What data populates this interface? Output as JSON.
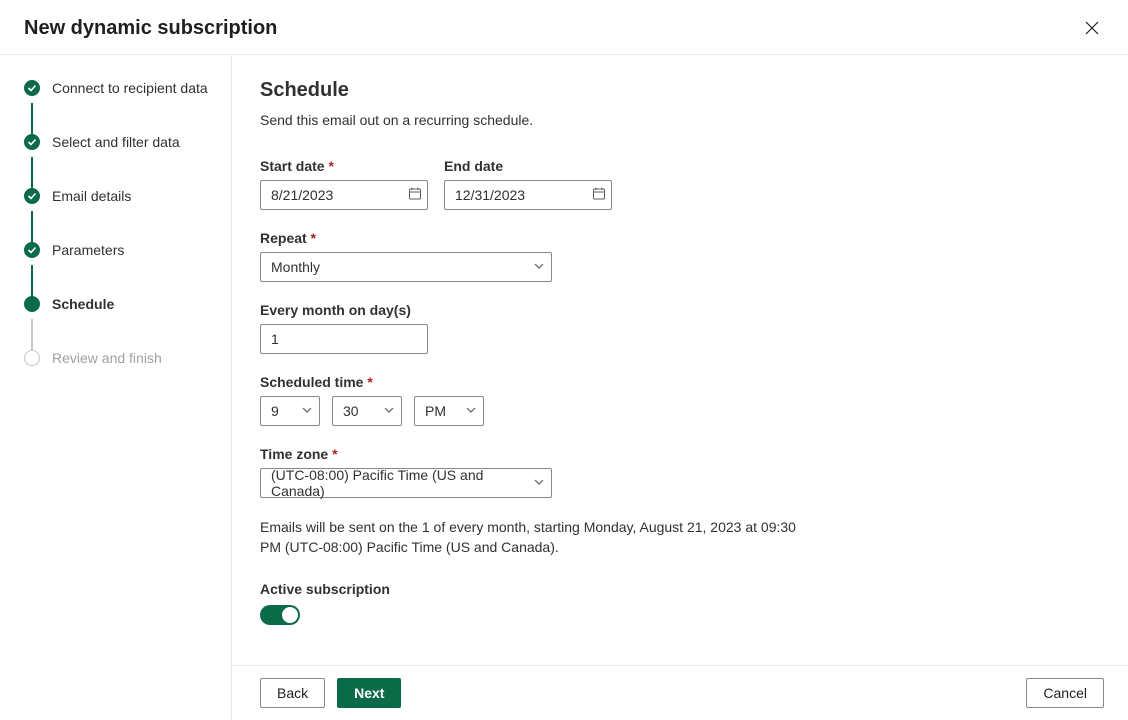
{
  "header": {
    "title": "New dynamic subscription"
  },
  "steps": [
    {
      "label": "Connect to recipient data",
      "state": "completed"
    },
    {
      "label": "Select and filter data",
      "state": "completed"
    },
    {
      "label": "Email details",
      "state": "completed"
    },
    {
      "label": "Parameters",
      "state": "completed"
    },
    {
      "label": "Schedule",
      "state": "current"
    },
    {
      "label": "Review and finish",
      "state": "pending"
    }
  ],
  "page": {
    "title": "Schedule",
    "desc": "Send this email out on a recurring schedule."
  },
  "form": {
    "start_date": {
      "label": "Start date",
      "value": "8/21/2023"
    },
    "end_date": {
      "label": "End date",
      "value": "12/31/2023"
    },
    "repeat": {
      "label": "Repeat",
      "value": "Monthly"
    },
    "month_days": {
      "label": "Every month on day(s)",
      "value": "1"
    },
    "scheduled_time": {
      "label": "Scheduled time",
      "hour": "9",
      "minute": "30",
      "ampm": "PM"
    },
    "time_zone": {
      "label": "Time zone",
      "value": "(UTC-08:00) Pacific Time (US and Canada)"
    },
    "summary": "Emails will be sent on the 1 of every month, starting Monday, August 21, 2023 at 09:30 PM (UTC-08:00) Pacific Time (US and Canada).",
    "active_subscription": {
      "label": "Active subscription",
      "value": true
    }
  },
  "footer": {
    "back": "Back",
    "next": "Next",
    "cancel": "Cancel"
  }
}
